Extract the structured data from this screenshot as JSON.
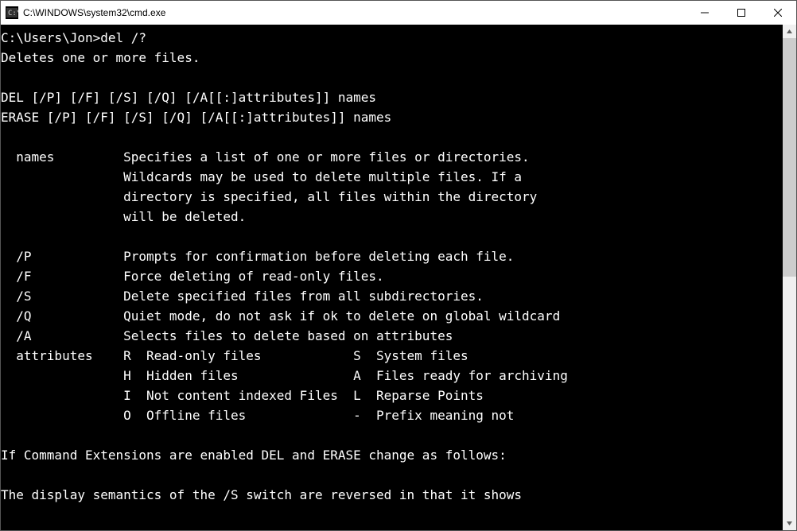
{
  "window": {
    "title": "C:\\WINDOWS\\system32\\cmd.exe"
  },
  "terminal": {
    "prompt": "C:\\Users\\Jon>",
    "command": "del /?",
    "output_lines": [
      "Deletes one or more files.",
      "",
      "DEL [/P] [/F] [/S] [/Q] [/A[[:]attributes]] names",
      "ERASE [/P] [/F] [/S] [/Q] [/A[[:]attributes]] names",
      "",
      "  names         Specifies a list of one or more files or directories.",
      "                Wildcards may be used to delete multiple files. If a",
      "                directory is specified, all files within the directory",
      "                will be deleted.",
      "",
      "  /P            Prompts for confirmation before deleting each file.",
      "  /F            Force deleting of read-only files.",
      "  /S            Delete specified files from all subdirectories.",
      "  /Q            Quiet mode, do not ask if ok to delete on global wildcard",
      "  /A            Selects files to delete based on attributes",
      "  attributes    R  Read-only files            S  System files",
      "                H  Hidden files               A  Files ready for archiving",
      "                I  Not content indexed Files  L  Reparse Points",
      "                O  Offline files              -  Prefix meaning not",
      "",
      "If Command Extensions are enabled DEL and ERASE change as follows:",
      "",
      "The display semantics of the /S switch are reversed in that it shows"
    ]
  }
}
